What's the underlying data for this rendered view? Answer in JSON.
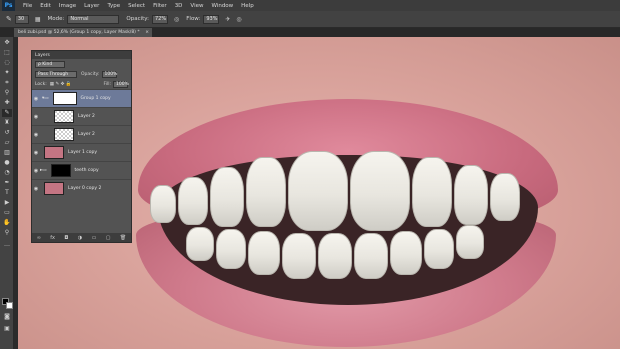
{
  "app": {
    "logo": "Ps",
    "menu": [
      "File",
      "Edit",
      "Image",
      "Layer",
      "Type",
      "Select",
      "Filter",
      "3D",
      "View",
      "Window",
      "Help"
    ]
  },
  "options_bar": {
    "brush_size": "30",
    "mode_label": "Mode:",
    "mode_value": "Normal",
    "opacity_label": "Opacity:",
    "opacity_value": "72%",
    "flow_label": "Flow:",
    "flow_value": "93%"
  },
  "document": {
    "tab_title": "beli zubi.psd @ 52,6% (Group 1 copy, Layer Mask/8) *",
    "close_symbol": "×"
  },
  "layers_panel": {
    "title": "Layers",
    "filter_value": "ρ Kind",
    "blend_mode": "Pass Through",
    "opacity_label": "Opacity:",
    "opacity_value": "100%",
    "lock_label": "Lock:",
    "fill_label": "Fill:",
    "fill_value": "100%",
    "layers": [
      {
        "name": "Group 1 copy",
        "selected": true
      },
      {
        "name": "Layer 2"
      },
      {
        "name": "Layer 2"
      },
      {
        "name": "Layer 1 copy"
      },
      {
        "name": "teeth copy"
      },
      {
        "name": "Layer 0 copy 2"
      }
    ],
    "footer_icons": [
      "link-icon",
      "fx-icon",
      "mask-icon",
      "adjustment-icon",
      "folder-icon",
      "new-layer-icon",
      "trash-icon"
    ],
    "footer_glyphs": [
      "∞",
      "fx",
      "◘",
      "◑",
      "▭",
      "▢",
      "🗑"
    ]
  },
  "colors": {
    "foreground": "#000000",
    "background": "#ffffff",
    "accent_selected_layer": "#6d7a99"
  }
}
